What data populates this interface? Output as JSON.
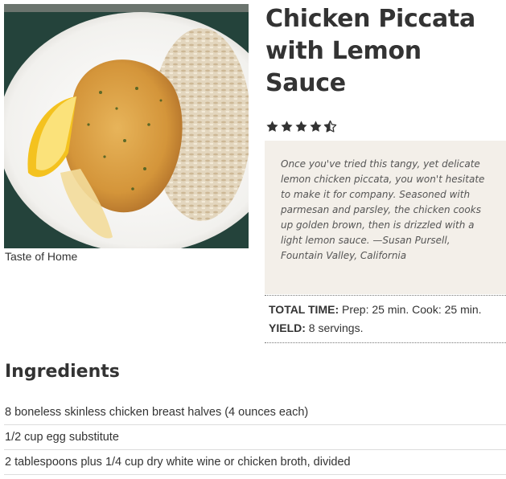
{
  "photo": {
    "caption": "Taste of Home"
  },
  "recipe": {
    "title": "Chicken Piccata with Lemon Sauce",
    "rating": 4.5,
    "description": "Once you've tried this tangy, yet delicate lemon chicken piccata, you won't hesitate to make it for company. Seasoned with parmesan and parsley, the chicken cooks up golden brown, then is drizzled with a light lemon sauce. —Susan Pursell, Fountain Valley, California",
    "total_time_label": "TOTAL TIME:",
    "total_time_value": "Prep: 25 min. Cook: 25 min.",
    "yield_label": "YIELD:",
    "yield_value": "8 servings."
  },
  "ingredients": {
    "heading": "Ingredients",
    "items": [
      "8 boneless skinless chicken breast halves (4 ounces each)",
      "1/2 cup egg substitute",
      "2 tablespoons plus 1/4 cup dry white wine or chicken broth, divided"
    ]
  },
  "colors": {
    "star": "#333333",
    "description_bg": "#f3efe9",
    "text": "#333333"
  },
  "icons": {
    "star_full": "star-icon",
    "star_half": "star-half-icon"
  }
}
